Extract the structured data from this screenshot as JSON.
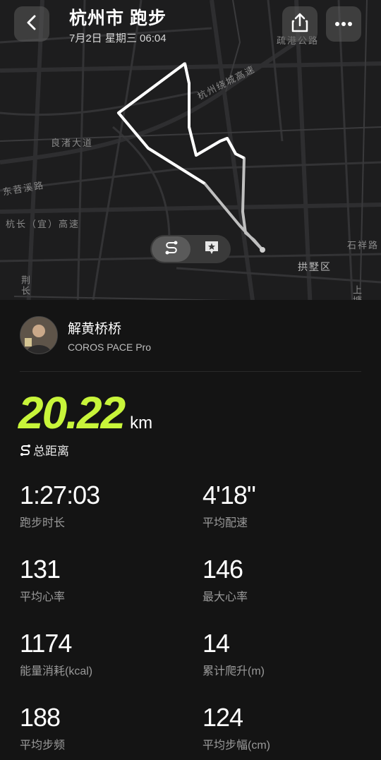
{
  "header": {
    "title": "杭州市 跑步",
    "subtitle": "7月2日 星期三 06:04",
    "back_icon": "chevron-left-icon",
    "share_icon": "share-icon",
    "more_icon": "more-icon"
  },
  "map": {
    "labels": [
      "疏港公路",
      "杭州绕城高速",
      "良渚大道",
      "东苕溪路",
      "杭长（宜）高速",
      "石祥路",
      "拱墅区",
      "荆长",
      "上塘"
    ],
    "controls": [
      "route-icon",
      "star-icon"
    ]
  },
  "user": {
    "name": "解黄桥桥",
    "device": "COROS PACE Pro"
  },
  "distance": {
    "value": "20.22",
    "unit": "km",
    "label": "总距离",
    "accent": "#c8f53a"
  },
  "stats": [
    {
      "value": "1:27:03",
      "label": "跑步时长"
    },
    {
      "value": "4'18\"",
      "label": "平均配速"
    },
    {
      "value": "131",
      "label": "平均心率"
    },
    {
      "value": "146",
      "label": "最大心率"
    },
    {
      "value": "1174",
      "label": "能量消耗(kcal)"
    },
    {
      "value": "14",
      "label": "累计爬升(m)"
    },
    {
      "value": "188",
      "label": "平均步频"
    },
    {
      "value": "124",
      "label": "平均步幅(cm)"
    }
  ]
}
